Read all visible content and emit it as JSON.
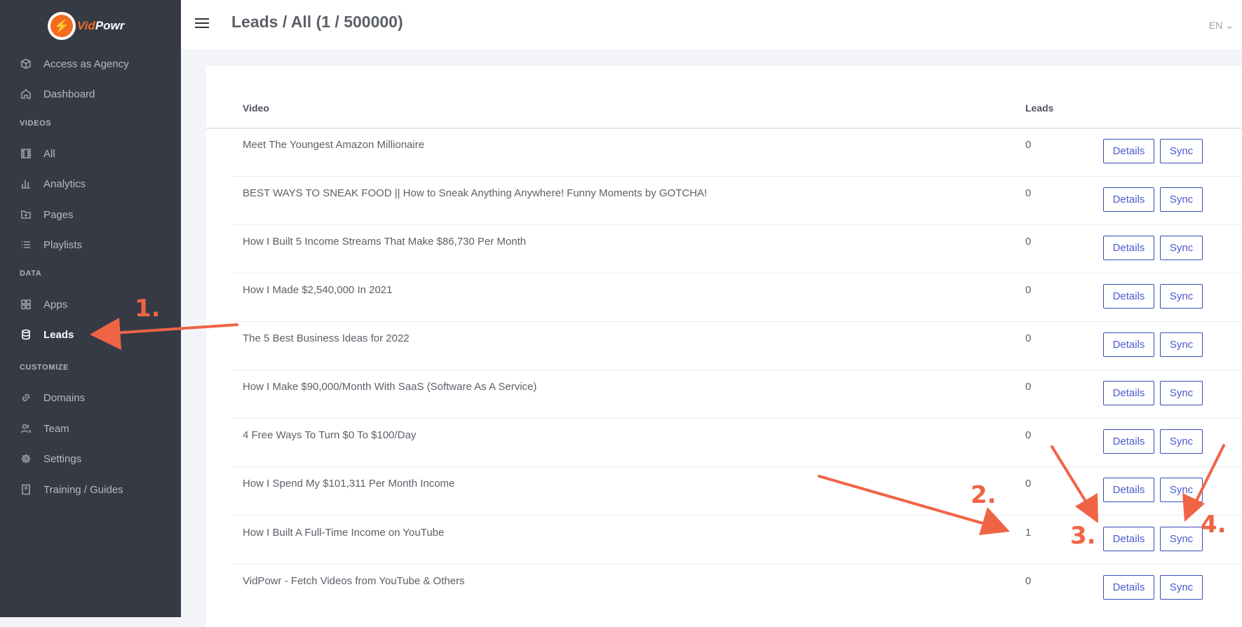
{
  "app": {
    "logo_prefix": "Vid",
    "logo_suffix": "Powr",
    "logo_symbol": "⚡"
  },
  "sidebar": {
    "items_top": [
      {
        "label": "Access as Agency",
        "icon": "cube-icon"
      },
      {
        "label": "Dashboard",
        "icon": "home-icon"
      }
    ],
    "sections": [
      {
        "label": "VIDEOS",
        "items": [
          {
            "label": "All",
            "icon": "film-icon"
          },
          {
            "label": "Analytics",
            "icon": "bar-chart-icon"
          },
          {
            "label": "Pages",
            "icon": "folder-plus-icon"
          },
          {
            "label": "Playlists",
            "icon": "list-icon"
          }
        ]
      },
      {
        "label": "DATA",
        "items": [
          {
            "label": "Apps",
            "icon": "grid-icon"
          },
          {
            "label": "Leads",
            "icon": "database-icon",
            "active": true
          }
        ]
      },
      {
        "label": "CUSTOMIZE",
        "items": [
          {
            "label": "Domains",
            "icon": "link-icon"
          },
          {
            "label": "Team",
            "icon": "users-icon"
          },
          {
            "label": "Settings",
            "icon": "gear-icon"
          },
          {
            "label": "Training / Guides",
            "icon": "book-icon"
          }
        ]
      }
    ]
  },
  "header": {
    "title": "Leads / All (1 / 500000)",
    "lang": "EN ⌄"
  },
  "table": {
    "columns": [
      "Video",
      "Leads"
    ],
    "details_label": "Details",
    "sync_label": "Sync",
    "rows": [
      {
        "video": "Meet The Youngest Amazon Millionaire",
        "leads": "0"
      },
      {
        "video": "BEST WAYS TO SNEAK FOOD || How to Sneak Anything Anywhere! Funny Moments by GOTCHA!",
        "leads": "0"
      },
      {
        "video": "How I Built 5 Income Streams That Make $86,730 Per Month",
        "leads": "0"
      },
      {
        "video": "How I Made $2,540,000 In 2021",
        "leads": "0"
      },
      {
        "video": "The 5 Best Business Ideas for 2022",
        "leads": "0"
      },
      {
        "video": "How I Make $90,000/Month With SaaS (Software As A Service)",
        "leads": "0"
      },
      {
        "video": "4 Free Ways To Turn $0 To $100/Day",
        "leads": "0"
      },
      {
        "video": "How I Spend My $101,311 Per Month Income",
        "leads": "0"
      },
      {
        "video": "How I Built A Full-Time Income on YouTube",
        "leads": "1"
      },
      {
        "video": "VidPowr - Fetch Videos from YouTube & Others",
        "leads": "0"
      }
    ]
  },
  "annotations": {
    "one": "1.",
    "two": "2.",
    "three": "3.",
    "four": "4.",
    "color": "#f06446"
  }
}
